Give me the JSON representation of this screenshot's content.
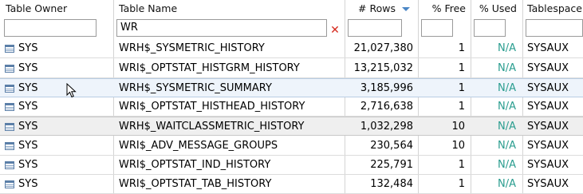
{
  "columns": {
    "owner": "Table Owner",
    "name": "Table Name",
    "rows": "# Rows",
    "free": "% Free",
    "used": "% Used",
    "tablespace": "Tablespace"
  },
  "filters": {
    "owner": "",
    "name": "WR",
    "rows": "",
    "free": "",
    "used": "",
    "tablespace": ""
  },
  "icons": {
    "sort": "sort-descending-icon",
    "clear": "clear-filter-icon",
    "row": "table-icon"
  },
  "colors": {
    "na": "#2a9d8f",
    "sort_arrow": "#4a86c5",
    "clear": "#d62a1e"
  },
  "rows": [
    {
      "owner": "SYS",
      "name": "WRH$_SYSMETRIC_HISTORY",
      "rows": "21,027,380",
      "free": "1",
      "used": "N/A",
      "tablespace": "SYSAUX"
    },
    {
      "owner": "SYS",
      "name": "WRI$_OPTSTAT_HISTGRM_HISTORY",
      "rows": "13,215,032",
      "free": "1",
      "used": "N/A",
      "tablespace": "SYSAUX"
    },
    {
      "owner": "SYS",
      "name": "WRH$_SYSMETRIC_SUMMARY",
      "rows": "3,185,996",
      "free": "1",
      "used": "N/A",
      "tablespace": "SYSAUX"
    },
    {
      "owner": "SYS",
      "name": "WRI$_OPTSTAT_HISTHEAD_HISTORY",
      "rows": "2,716,638",
      "free": "1",
      "used": "N/A",
      "tablespace": "SYSAUX"
    },
    {
      "owner": "SYS",
      "name": "WRH$_WAITCLASSMETRIC_HISTORY",
      "rows": "1,032,298",
      "free": "10",
      "used": "N/A",
      "tablespace": "SYSAUX"
    },
    {
      "owner": "SYS",
      "name": "WRI$_ADV_MESSAGE_GROUPS",
      "rows": "230,564",
      "free": "10",
      "used": "N/A",
      "tablespace": "SYSAUX"
    },
    {
      "owner": "SYS",
      "name": "WRI$_OPTSTAT_IND_HISTORY",
      "rows": "225,791",
      "free": "1",
      "used": "N/A",
      "tablespace": "SYSAUX"
    },
    {
      "owner": "SYS",
      "name": "WRI$_OPTSTAT_TAB_HISTORY",
      "rows": "132,484",
      "free": "1",
      "used": "N/A",
      "tablespace": "SYSAUX"
    }
  ]
}
